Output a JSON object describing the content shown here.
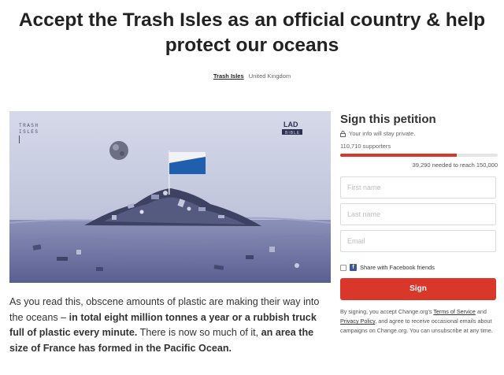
{
  "page": {
    "title_line1": "Accept the Trash Isles as an official country & help",
    "title_line2": "protect our oceans",
    "organization": "Trash Isles",
    "location": "United Kingdom"
  },
  "hero": {
    "logo_top": "TRASH",
    "logo_bottom": "ISLES",
    "badge_top": "LAD",
    "badge_bottom": "BIBLE"
  },
  "body": {
    "p1": "As you read this, obscene amounts of plastic are making their way into the oceans – ",
    "b1": "in total eight million tonnes a year or a rubbish truck full of plastic every minute.",
    "p2": " There is now so much of it, ",
    "b2": "an area the size of France has formed in the Pacific Ocean."
  },
  "sign": {
    "heading": "Sign this petition",
    "private_note": "Your info will stay private.",
    "supporters": "110,710 supporters",
    "progress_fraction": 0.738,
    "needed": "39,290 needed to reach 150,000",
    "first_name_placeholder": "First name",
    "last_name_placeholder": "Last name",
    "email_placeholder": "Email",
    "facebook_label": "Share with Facebook friends",
    "button_label": "Sign",
    "legal_prefix": "By signing, you accept Change.org's ",
    "terms_link": "Terms of Service",
    "legal_and": " and ",
    "privacy_link": "Privacy Policy",
    "legal_suffix": ", and agree to receive occasional emails about campaigns on Change.org. You can unsubscribe at any time."
  },
  "colors": {
    "accent": "#d9372a",
    "facebook": "#3b5998",
    "flag_blue": "#1f5fae"
  },
  "icons": [
    "lock-icon",
    "facebook-icon",
    "checkbox"
  ]
}
